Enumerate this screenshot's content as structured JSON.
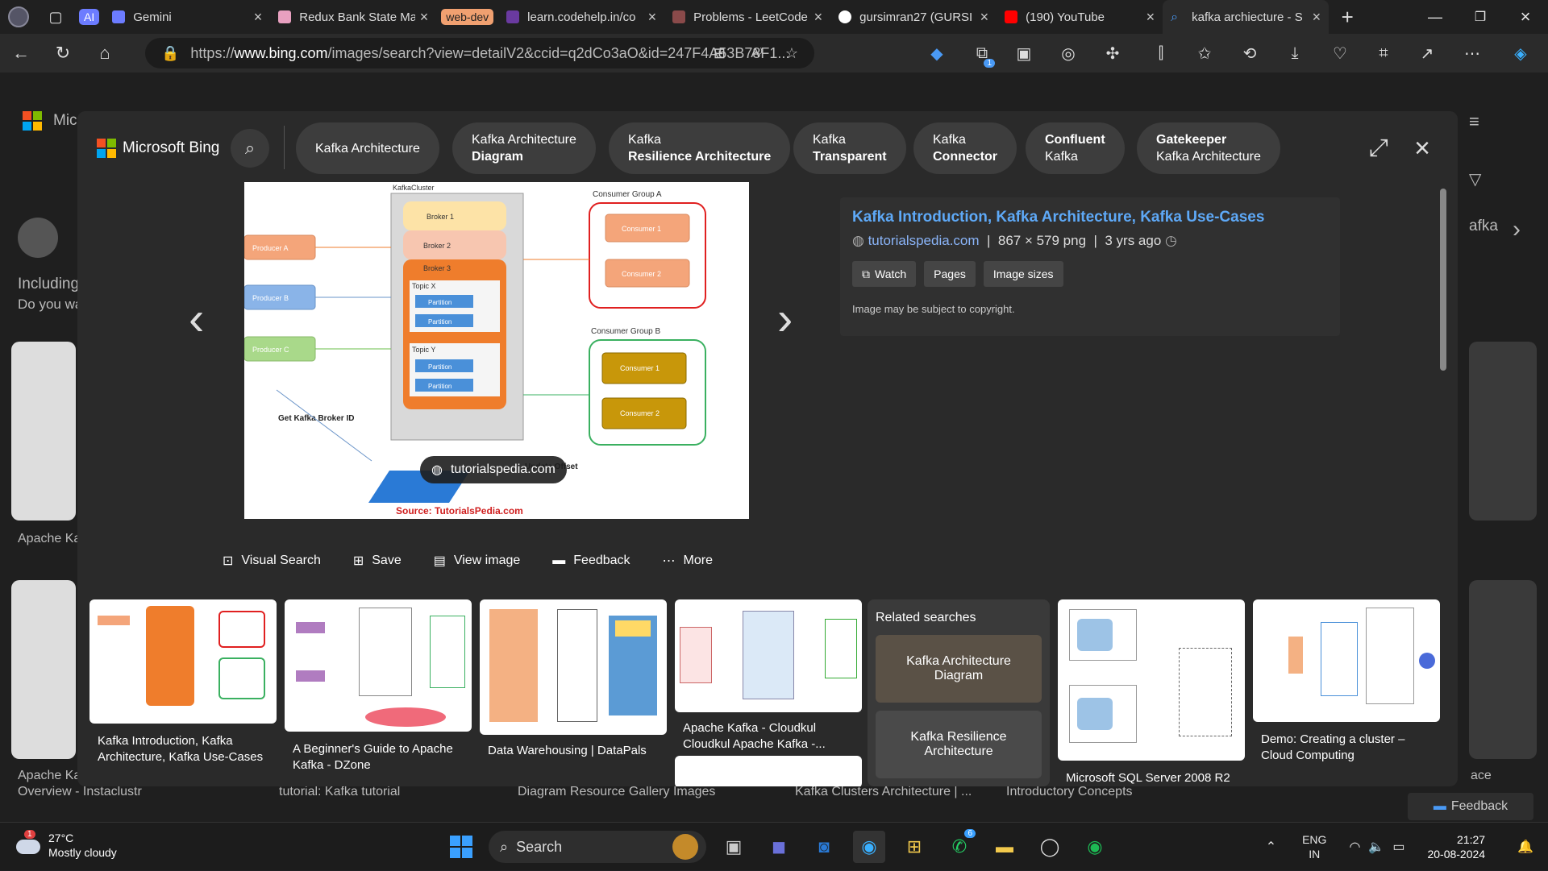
{
  "tabs": [
    {
      "group": "AI",
      "label": "Gemini",
      "color": "#6c7cff"
    },
    {
      "label": "Redux Bank State Ma",
      "color": "#e8a0c0"
    },
    {
      "group": "web-dev",
      "label": "learn.codehelp.in/co",
      "color": "#6a3aa0"
    },
    {
      "label": "Problems - LeetCode",
      "color": "#8a4a4a"
    },
    {
      "label": "gursimran27 (GURSI",
      "color": "#ffffff"
    },
    {
      "label": "(190) YouTube",
      "color": "#ff0000"
    },
    {
      "label": "kafka archiecture - S",
      "color": "#4a9af5",
      "active": true
    }
  ],
  "address": {
    "scheme": "https://",
    "host": "www.bing.com",
    "path": "/images/search?view=detailV2&ccid=q2dCo3aO&id=247F4A53B78F1..."
  },
  "toolbar": {
    "badge_count": "1"
  },
  "background": {
    "left_text_1": "Micr",
    "left_text_2": "Including",
    "left_text_3": "Do you wa",
    "left_text_4": "Apache Ka",
    "left_text_5": "Apache Ka",
    "left_text_6": "Overview - Instaclustr",
    "bottom_caps": [
      "tutorial: Kafka tutorial",
      "Diagram Resource Gallery Images",
      "Kafka Clusters Architecture | ...",
      "Introductory Concepts"
    ],
    "right_text": "afka",
    "right_cap": "ace",
    "feedback": "Feedback"
  },
  "overlay": {
    "logo": "Microsoft Bing",
    "chips": [
      {
        "l1": "Kafka Architecture",
        "l2": ""
      },
      {
        "l1": "Kafka Architecture",
        "l2": "Diagram"
      },
      {
        "l1": "Kafka",
        "l2": "Resilience Architecture"
      },
      {
        "l1": "Kafka",
        "l2": "Transparent"
      },
      {
        "l1": "Kafka",
        "l2": "Connector"
      },
      {
        "l1": "Confluent",
        "l2": "Kafka",
        "bold1": true
      },
      {
        "l1": "Gatekeeper",
        "l2": "Kafka Architecture",
        "bold1": true
      }
    ],
    "image": {
      "source_badge": "tutorialspedia.com",
      "diagram": {
        "cluster": "KafkaCluster",
        "brokers": [
          "Broker 1",
          "Broker 2",
          "Broker 3"
        ],
        "topic_x": "Topic X",
        "topic_y": "Topic Y",
        "partition": "Partition",
        "producers": [
          "Producer A",
          "Producer B",
          "Producer C"
        ],
        "group_a": "Consumer Group A",
        "group_b": "Consumer Group B",
        "consumer_1": "Consumer 1",
        "consumer_2": "Consumer 2",
        "broker_id": "Get Kafka Broker ID",
        "update": "Update Offset",
        "source": "Source: TutorialsPedia.com"
      }
    },
    "info": {
      "title": "Kafka Introduction, Kafka Architecture, Kafka Use-Cases",
      "source": "tutorialspedia.com",
      "dims": "867 × 579 png",
      "age": "3 yrs ago",
      "buttons": [
        "Watch",
        "Pages",
        "Image sizes"
      ],
      "copyright": "Image may be subject to copyright."
    },
    "actions": [
      "Visual Search",
      "Save",
      "View image",
      "Feedback",
      "More"
    ],
    "thumbs": [
      {
        "caption": "Kafka Introduction, Kafka Architecture, Kafka Use-Cases"
      },
      {
        "caption": "A Beginner's Guide to Apache Kafka - DZone"
      },
      {
        "caption": "Data Warehousing | DataPals"
      },
      {
        "caption": "Apache Kafka - Cloudkul Cloudkul Apache Kafka -..."
      },
      {
        "caption": "Microsoft SQL Server 2008 R2"
      },
      {
        "caption": "Demo: Creating a cluster – Cloud Computing"
      }
    ],
    "related": {
      "title": "Related searches",
      "items": [
        "Kafka Architecture Diagram",
        "Kafka Resilience Architecture"
      ]
    }
  },
  "taskbar": {
    "weather": {
      "temp": "27°C",
      "desc": "Mostly cloudy",
      "alert": "1"
    },
    "search": "Search",
    "teams_badge": "6",
    "lang": "ENG",
    "region": "IN",
    "time": "21:27",
    "date": "20-08-2024"
  }
}
